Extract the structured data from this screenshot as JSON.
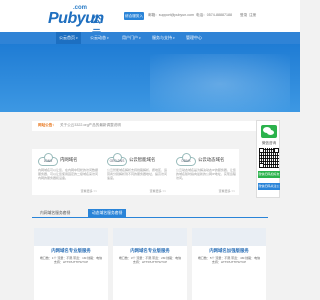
{
  "header": {
    "logo_domain": ".com",
    "logo_word": "Pubyun",
    "logo_cn": "公云",
    "top_button": "综合服务入口",
    "email": "邮箱：support@pubyun.com",
    "phone": "电话：0574-88887188",
    "login": "登录",
    "register": "注册"
  },
  "nav": {
    "items": [
      "公云首页",
      "公云动态",
      "用户门户",
      "服务与支持",
      "管理中心"
    ]
  },
  "notice": {
    "tag": "网站公告：",
    "text": "关于公云3322.org产品的最新调整说明"
  },
  "cards": [
    {
      "icon_label": "LDNS",
      "title": "内网域名",
      "desc": "内网域名可以让您，在内网中轻松的访问数据服务器，可以让您使用固定的二级域名来访问内网的服务器和设备。",
      "more": "查看更多 >>"
    },
    {
      "icon_label": "GEO.DNS",
      "title": "公云智能域名",
      "desc": "公云智能域名解析支持线路解析，按地区、运营商分别解析到不同的服务器地址，提高访问速度。",
      "more": "查看更多 >>"
    },
    {
      "icon_label": "DDNS",
      "title": "公云动态域名",
      "desc": "公云动态域名是为解决动态IP的服务器，让您的域名随时指向最新的公网IP地址，实现远程访问。",
      "more": "查看更多 >>"
    }
  ],
  "wechat": {
    "label": "微信咨询",
    "button1": "微信扫码加好友",
    "button2": "微信扫码关注公众号"
  },
  "tabs": [
    {
      "label": "内网域名服务套餐",
      "active": false
    },
    {
      "label": "动态域名服务套餐",
      "active": true
    }
  ],
  "plans": [
    {
      "name": "内网域名专业版服务",
      "specs": "端口数：1个  流量：不限  带宽：1M  线路：电信 支持：HTTP/HTTPS/TCP"
    },
    {
      "name": "内网域名专业版服务",
      "specs": "端口数：3个  流量：不限  带宽：2M  线路：电信 支持：HTTP/HTTPS/TCP"
    },
    {
      "name": "内网域名加强版服务",
      "specs": "端口数：5个  流量：不限  带宽：4M  线路：电信 支持：HTTP/HTTPS/TCP"
    }
  ],
  "colors": {
    "primary": "#2f83d6",
    "nav_active": "#1d6fc1",
    "notice_tag": "#e8761c",
    "wechat_green": "#2bb24c"
  }
}
